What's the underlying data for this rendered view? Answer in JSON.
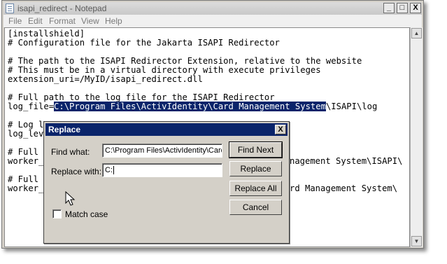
{
  "window": {
    "title": "isapi_redirect - Notepad",
    "controls": {
      "minimize": "_",
      "maximize": "□",
      "close": "X"
    }
  },
  "menu": [
    "File",
    "Edit",
    "Format",
    "View",
    "Help"
  ],
  "editor": {
    "lines": [
      "[installshield]",
      "# Configuration file for the Jakarta ISAPI Redirector",
      "",
      "# The path to the ISAPI Redirector Extension, relative to the website",
      "# This must be in a virtual directory with execute privileges",
      "extension_uri=/MyID/isapi_redirect.dll",
      "",
      "# Full path to the log file for the ISAPI Redirector",
      "",
      "",
      "# Log l",
      "log_lev",
      "",
      "# Full",
      "worker_",
      "",
      "# Full",
      "worker_"
    ],
    "log_file": {
      "prefix": "log_file=",
      "selected": "C:\\Program Files\\ActivIdentity\\Card Management System",
      "suffix": "\\ISAPI\\log"
    },
    "behind_dialog": {
      "line_14_tail": "nagement System\\ISAPI\\",
      "line_18_tail": "rd Management System\\"
    }
  },
  "dialog": {
    "title": "Replace",
    "close_label": "X",
    "find_label": "Find what:",
    "find_value": "C:\\Program Files\\ActivIdentity\\Card",
    "replace_label": "Replace with:",
    "replace_value": "C:",
    "match_case_label": "Match case",
    "buttons": {
      "find_next": "Find Next",
      "replace": "Replace",
      "replace_all": "Replace All",
      "cancel": "Cancel"
    }
  }
}
